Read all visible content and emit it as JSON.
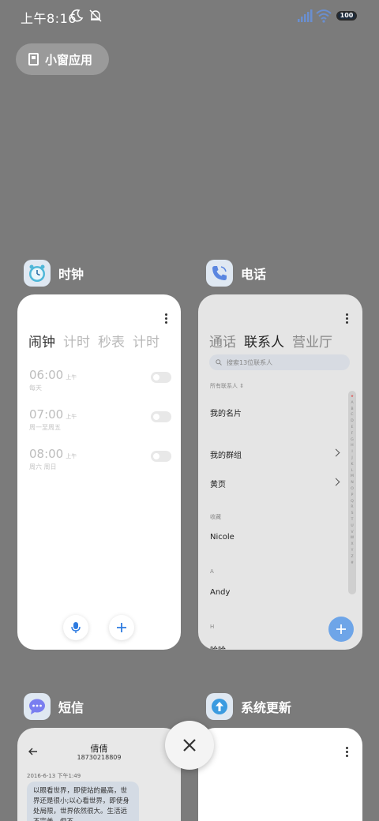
{
  "status_bar": {
    "time": "上午8:16",
    "battery": "100"
  },
  "float_pill": {
    "label": "小窗应用"
  },
  "apps": {
    "clock": {
      "name": "时钟",
      "tabs": [
        "闹钟",
        "计时",
        "秒表",
        "计时"
      ],
      "alarms": [
        {
          "time": "06:00",
          "ampm": "上午",
          "repeat": "每天"
        },
        {
          "time": "07:00",
          "ampm": "上午",
          "repeat": "周一至周五"
        },
        {
          "time": "08:00",
          "ampm": "上午",
          "repeat": "周六 周日"
        }
      ]
    },
    "phone": {
      "name": "电话",
      "tabs": [
        "通话",
        "联系人",
        "营业厅"
      ],
      "search_placeholder": "搜索13位联系人",
      "all_contacts": "所有联系人",
      "my_card": "我的名片",
      "my_groups": "我的群组",
      "yellow_pages": "黄页",
      "favorites_label": "收藏",
      "contact_1": "Nicole",
      "section_a": "A",
      "contact_2": "Andy",
      "section_h": "H",
      "contact_3": "哈哈",
      "index": [
        "★",
        "A",
        "B",
        "C",
        "D",
        "E",
        "F",
        "G",
        "H",
        "I",
        "J",
        "K",
        "L",
        "M",
        "N",
        "O",
        "P",
        "Q",
        "R",
        "S",
        "T",
        "U",
        "V",
        "W",
        "X",
        "Y",
        "Z",
        "#"
      ]
    },
    "sms": {
      "name": "短信",
      "contact": "倩倩",
      "number": "18730218809",
      "date": "2016-6-13 下午1:49",
      "message": "以眼看世界，即使站的最高，世界还是很小;以心看世界，即使身处局限，世界依然很大。生活远不完美，但不"
    },
    "update": {
      "name": "系统更新"
    }
  },
  "colors": {
    "background": "#7b7b7b",
    "accent_blue": "#6ea5e8",
    "clock_icon": "#4fb7d8"
  }
}
